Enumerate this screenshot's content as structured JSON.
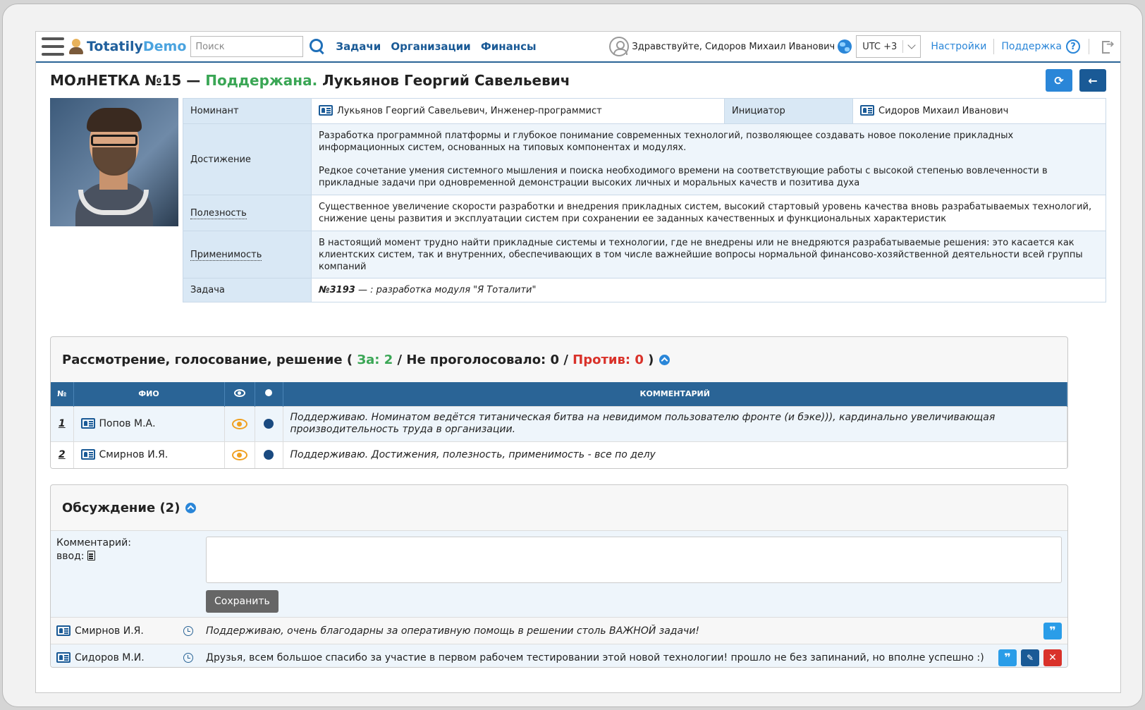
{
  "header": {
    "logo_prefix": "Totatily",
    "logo_suffix": "Demo",
    "search_placeholder": "Поиск",
    "nav": [
      "Задачи",
      "Организации",
      "Финансы"
    ],
    "greeting": "Здравствуйте, Сидоров Михаил Иванович",
    "timezone": "UTC +3",
    "settings": "Настройки",
    "support": "Поддержка",
    "help_glyph": "?"
  },
  "title": {
    "prefix": "МОлНЕТКА №15 — ",
    "status": "Поддержана.",
    "name": " Лукьянов Георгий Савельевич",
    "status_color": "#3aa655"
  },
  "info": {
    "nominee_label": "Номинант",
    "nominee_value": "Лукьянов Георгий Савельевич, Инженер-программист",
    "initiator_label": "Инициатор",
    "initiator_value": "Сидоров Михаил Иванович",
    "achievement_label": "Достижение",
    "achievement_p1": "Разработка программной платформы и глубокое понимание современных технологий, позволяющее создавать новое поколение прикладных информационных систем, основанных на типовых компонентах и модулях.",
    "achievement_p2": "Редкое сочетание умения системного мышления и поиска необходимого времени на соответствующие работы с высокой степенью вовлеченности в прикладные задачи при одновременной демонстрации высоких личных и моральных качеств и позитива духа",
    "usefulness_label": "Полезность",
    "usefulness_value": "Существенное увеличение скорости разработки и внедрения прикладных систем, высокий стартовый уровень качества вновь разрабатываемых технологий, снижение цены развития и эксплуатации систем при сохранении ее заданных качественных и функциональных характеристик",
    "applicability_label": "Применимость",
    "applicability_value": "В настоящий момент трудно найти прикладные системы и технологии, где не внедрены или не внедряются разрабатываемые решения: это касается как клиентских систем, так и внутренних, обеспечивающих в том числе важнейшие вопросы нормальной финансово-хозяйственной деятельности всей группы компаний",
    "task_label": "Задача",
    "task_number": "№3193",
    "task_text": " — : разработка модуля \"Я Тоталити\""
  },
  "votes": {
    "title": "Рассмотрение, голосование, решение",
    "open": " ( ",
    "for_text": "За: 2",
    "sep1": " / Не проголосовало: 0 / ",
    "against_text": "Против: 0",
    "close": " )",
    "columns": {
      "num": "№",
      "name": "ФИО",
      "comment": "КОММЕНТАРИЙ"
    },
    "rows": [
      {
        "num": "1",
        "name": "Попов М.А.",
        "comment": "Поддерживаю. Номинатом ведётся титаническая битва на невидимом пользователю фронте (и бэке))), кардинально увеличивающая производительность труда в организации."
      },
      {
        "num": "2",
        "name": "Смирнов И.Я.",
        "comment": "Поддерживаю. Достижения, полезность, применимость - все по делу"
      }
    ]
  },
  "discussion": {
    "title": "Обсуждение (2)",
    "comment_label": "Комментарий:",
    "input_label": "ввод:",
    "save": "Сохранить",
    "messages": [
      {
        "author": "Смирнов И.Я.",
        "text": "Поддерживаю, очень благодарны за оперативную помощь в решении столь ВАЖНОЙ задачи!"
      },
      {
        "author": "Сидоров М.И.",
        "text": "Друзья, всем большое спасибо за участие в первом рабочем тестировании этой новой технологии! прошло не без запинаний, но вполне успешно :)"
      }
    ]
  },
  "colors": {
    "accent": "#2a86d8",
    "header_blue": "#2a6496",
    "green": "#3aa655",
    "red": "#d9322a"
  },
  "icons": [
    "menu-icon",
    "logo-icon",
    "search-icon",
    "user-icon",
    "globe-icon",
    "help-icon",
    "exit-icon",
    "refresh-icon",
    "back-icon",
    "card-icon",
    "eye-icon",
    "dot-icon",
    "collapse-icon",
    "document-icon",
    "clock-icon",
    "quote-icon",
    "edit-icon",
    "delete-icon"
  ]
}
